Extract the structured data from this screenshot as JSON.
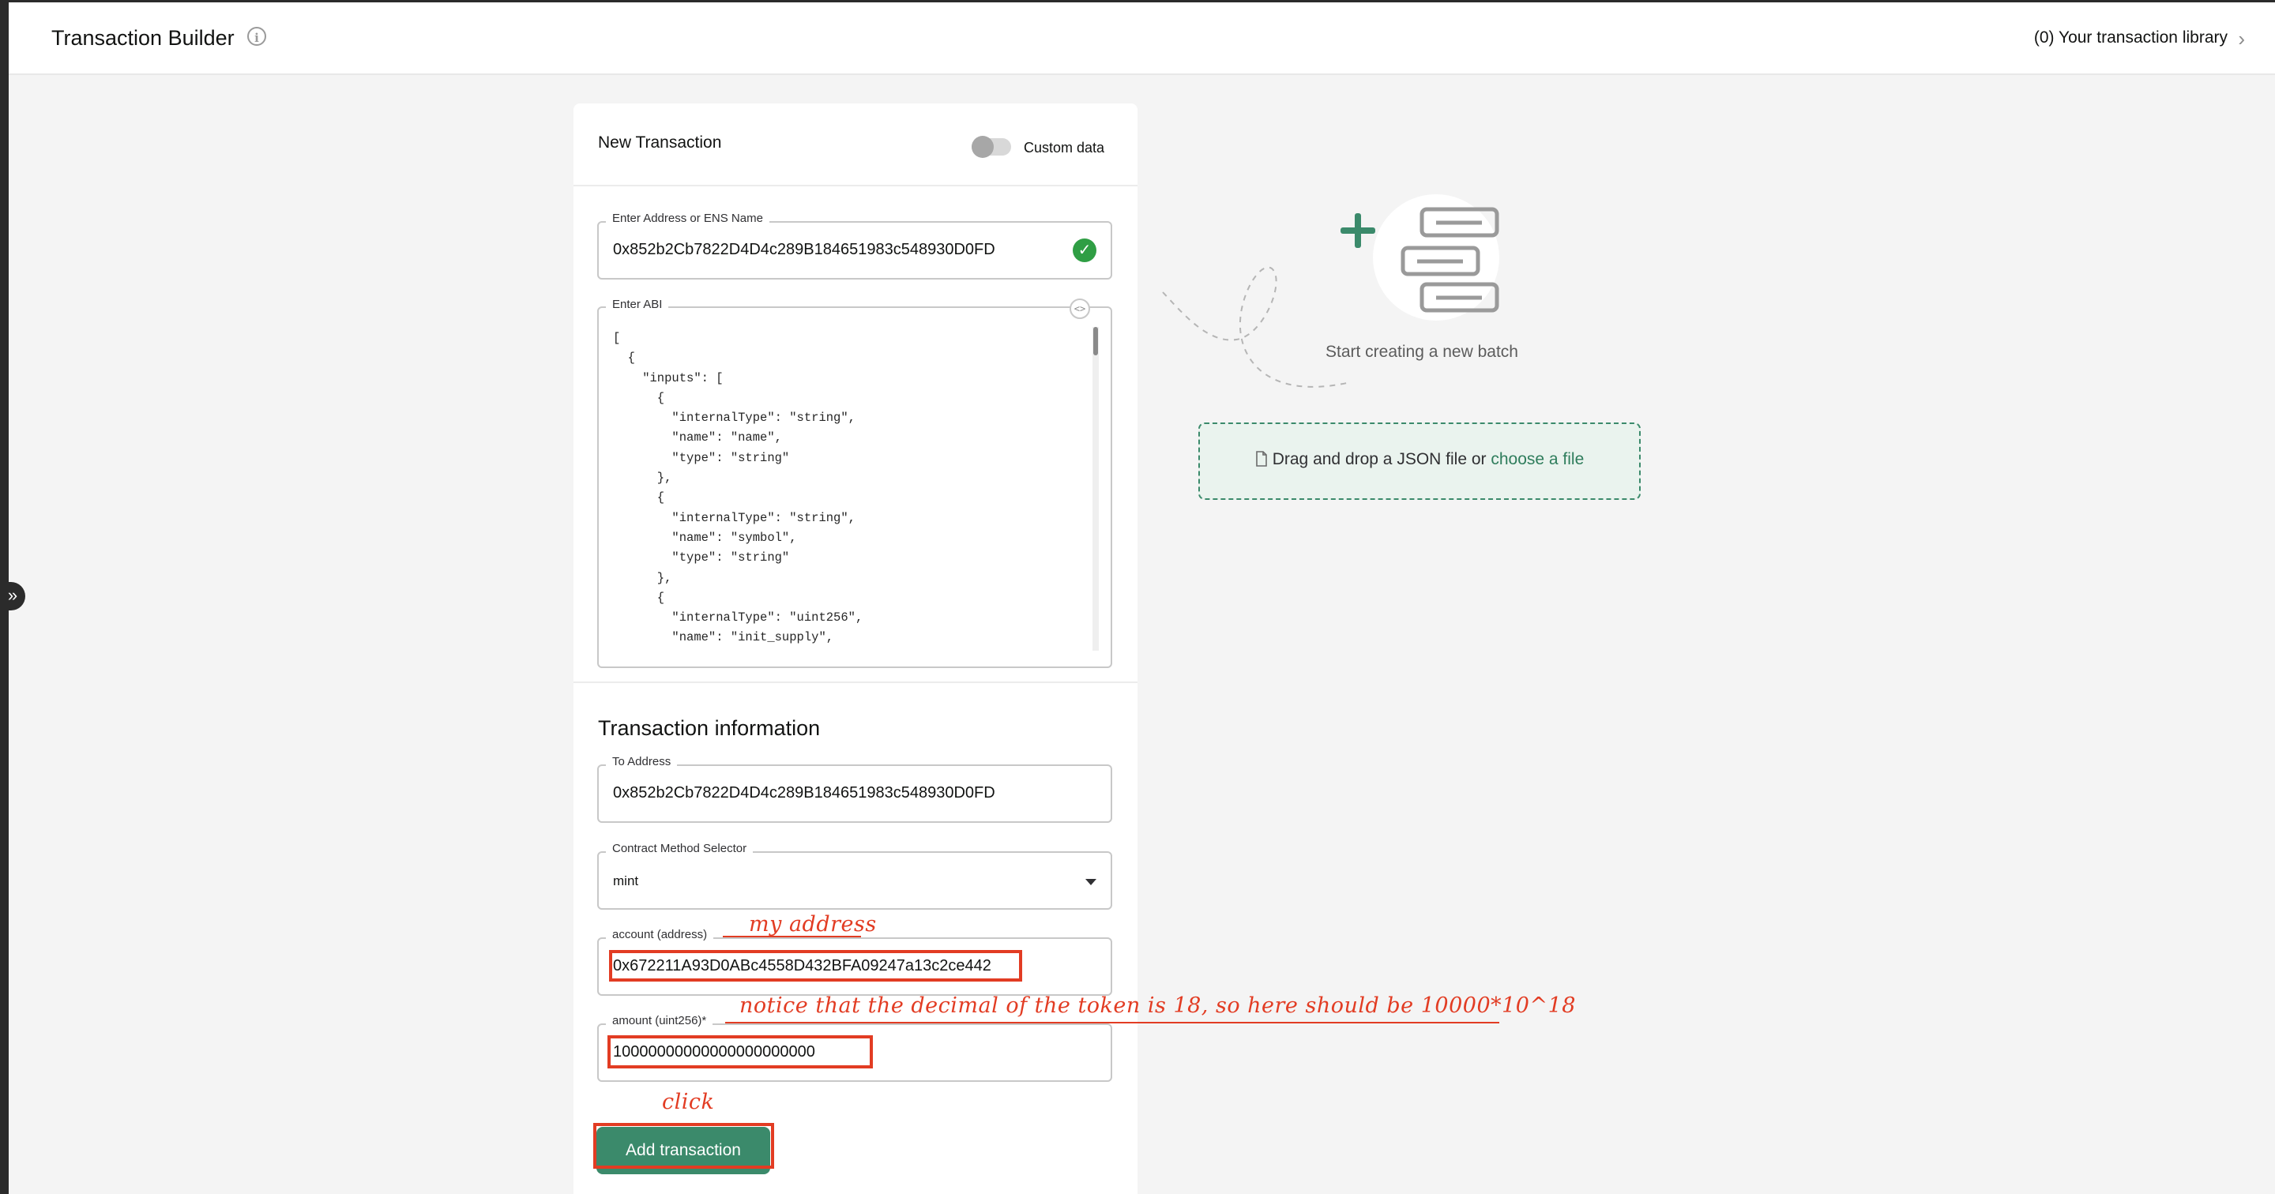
{
  "header": {
    "title": "Transaction Builder",
    "info_icon": "info-icon",
    "library_link": "(0) Your transaction library",
    "chevron_icon": "chevron-right-icon"
  },
  "sidebar_toggle": {
    "icon": "double-chevron-right-icon",
    "glyph": "»"
  },
  "new_transaction": {
    "title": "New Transaction",
    "custom_data_label": "Custom data",
    "custom_data_enabled": false,
    "address_field": {
      "label": "Enter Address or ENS Name",
      "value": "0x852b2Cb7822D4D4c289B184651983c548930D0FD",
      "valid_icon": "check-circle-icon"
    },
    "abi_field": {
      "label": "Enter ABI",
      "code_toggle_icon": "code-icon",
      "lines": [
        "[",
        "  {",
        "    \"inputs\": [",
        "      {",
        "        \"internalType\": \"string\",",
        "        \"name\": \"name\",",
        "        \"type\": \"string\"",
        "      },",
        "      {",
        "        \"internalType\": \"string\",",
        "        \"name\": \"symbol\",",
        "        \"type\": \"string\"",
        "      },",
        "      {",
        "        \"internalType\": \"uint256\",",
        "        \"name\": \"init_supply\","
      ]
    }
  },
  "transaction_info": {
    "title": "Transaction information",
    "to_address": {
      "label": "To Address",
      "value": "0x852b2Cb7822D4D4c289B184651983c548930D0FD"
    },
    "method_selector": {
      "label": "Contract Method Selector",
      "value": "mint"
    },
    "account": {
      "label": "account (address)",
      "value": "0x672211A93D0ABc4558D432BFA09247a13c2ce442"
    },
    "amount": {
      "label": "amount (uint256)*",
      "value": "10000000000000000000000"
    },
    "add_button": "Add transaction"
  },
  "annotations": {
    "account_note": "my address",
    "amount_note": "notice that the decimal of the token is 18, so here should be 10000*10^18",
    "click_note": "click",
    "color": "#e23c23"
  },
  "batch": {
    "caption": "Start creating a new batch",
    "icon": "add-batch-illustration-icon",
    "dropzone_text": "Drag and drop a JSON file or",
    "dropzone_link": "choose a file",
    "file_icon": "file-icon"
  },
  "colors": {
    "primary": "#3b8a6b",
    "success": "#2f9e44",
    "background": "#f4f4f4"
  }
}
